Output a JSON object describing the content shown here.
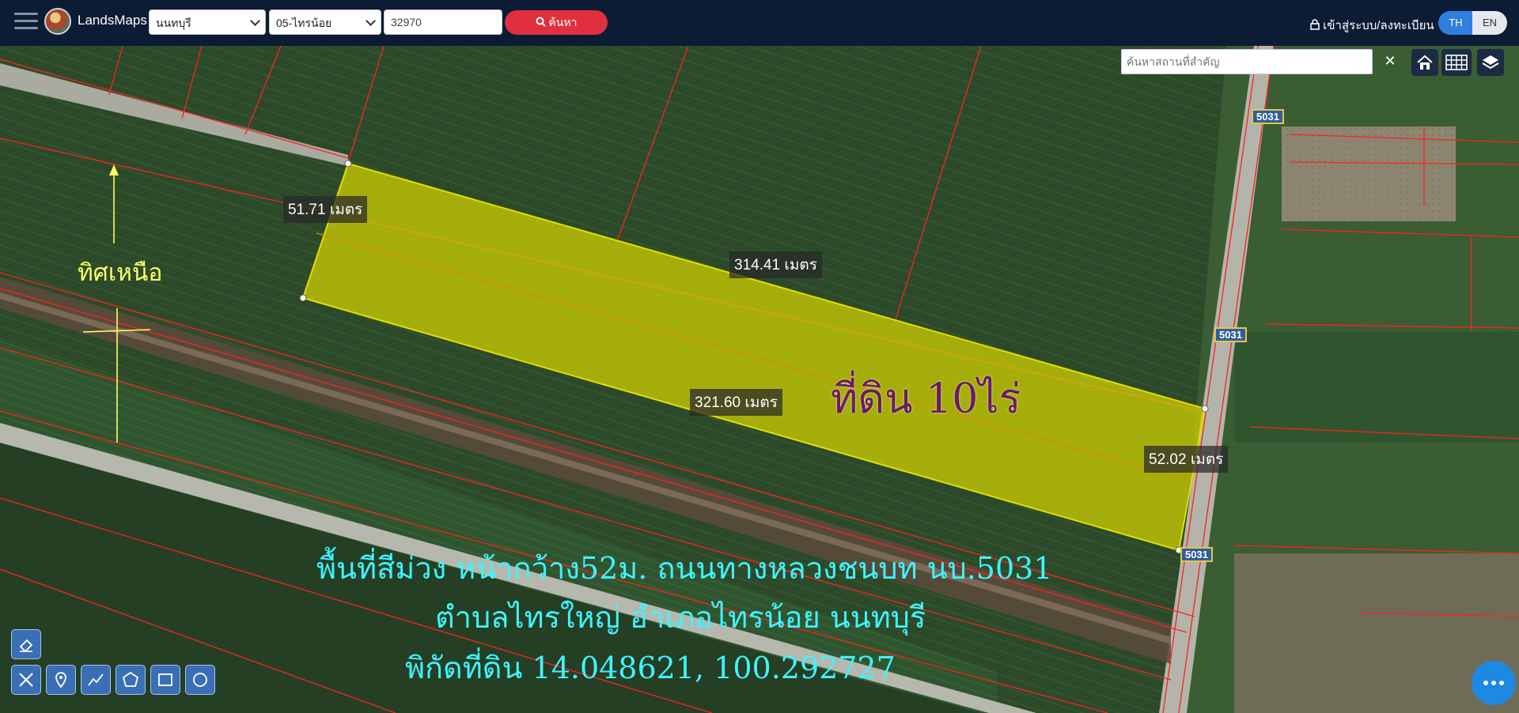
{
  "header": {
    "brand": "LandsMaps",
    "province": "นนทบุรี",
    "district": "05-ไทรน้อย",
    "parcel_no": "32970",
    "search_label": "ค้นหา",
    "login_label": "เข้าสู่ระบบ/ลงทะเบียน",
    "lang_th": "TH",
    "lang_en": "EN"
  },
  "map_search": {
    "placeholder": "ค้นหาสถานที่สำคัญ",
    "clear": "✕"
  },
  "measurements": {
    "left_side": "51.71 เมตร",
    "top_side": "314.41 เมตร",
    "bottom_side": "321.60 เมตร",
    "right_side": "52.02 เมตร"
  },
  "road_badges": [
    "5031",
    "5031",
    "5031"
  ],
  "annotations": {
    "north": "ทิศเหนือ",
    "area": "ที่ดิน 10ไร่",
    "line1": "พื้นที่สีม่วง หน้ากว้าง52ม. ถนนทางหลวงชนบท นบ.5031",
    "line2": "ตำบลไทรใหญ่ อำเภอไทรน้อย นนทบุรี",
    "line3": "พิกัดที่ดิน 14.048621, 100.292727"
  },
  "colors": {
    "header_bg": "#0c1c34",
    "search_btn": "#e0303f",
    "parcel_fill": "#d4d400",
    "annotation_cyan": "#3ff3ff",
    "annotation_purple": "#6a1a6a",
    "north_yellow": "#ffff66"
  }
}
